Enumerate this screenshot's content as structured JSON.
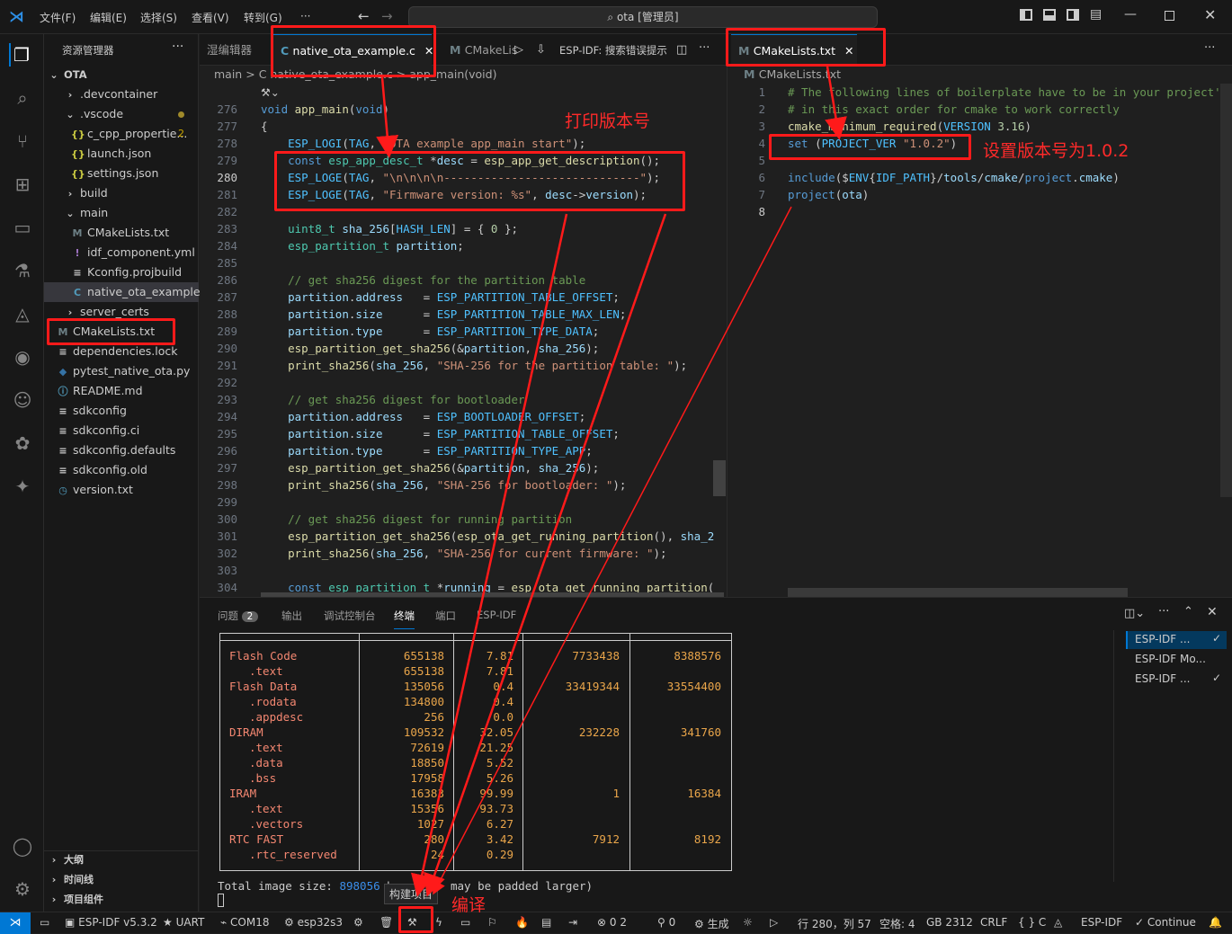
{
  "titlebar": {
    "menus": [
      "文件(F)",
      "编辑(E)",
      "选择(S)",
      "查看(V)",
      "转到(G)",
      "···"
    ],
    "search_text": "ota [管理员]"
  },
  "sidebar": {
    "title": "资源管理器",
    "root": "OTA",
    "items": [
      {
        "label": ".devcontainer",
        "icon": "chevron-right"
      },
      {
        "label": ".vscode",
        "icon": "chevron-down"
      },
      {
        "label": "c_cpp_propertie...",
        "icon": "json",
        "badge": "2"
      },
      {
        "label": "launch.json",
        "icon": "json"
      },
      {
        "label": "settings.json",
        "icon": "json"
      },
      {
        "label": "build",
        "icon": "chevron-right"
      },
      {
        "label": "main",
        "icon": "chevron-down"
      },
      {
        "label": "CMakeLists.txt",
        "icon": "cmake"
      },
      {
        "label": "idf_component.yml",
        "icon": "yaml"
      },
      {
        "label": "Kconfig.projbuild",
        "icon": "lines"
      },
      {
        "label": "native_ota_example.c",
        "icon": "c"
      },
      {
        "label": "server_certs",
        "icon": "chevron-right"
      },
      {
        "label": "CMakeLists.txt",
        "icon": "cmake"
      },
      {
        "label": "dependencies.lock",
        "icon": "lines"
      },
      {
        "label": "pytest_native_ota.py",
        "icon": "python"
      },
      {
        "label": "README.md",
        "icon": "info"
      },
      {
        "label": "sdkconfig",
        "icon": "lines"
      },
      {
        "label": "sdkconfig.ci",
        "icon": "lines"
      },
      {
        "label": "sdkconfig.defaults",
        "icon": "lines"
      },
      {
        "label": "sdkconfig.old",
        "icon": "lines"
      },
      {
        "label": "version.txt",
        "icon": "clock"
      }
    ],
    "sections": [
      "大纲",
      "时间线",
      "项目组件"
    ]
  },
  "editor1": {
    "tabs": [
      "湿编辑器",
      "native_ota_example.c",
      "CMakeLis",
      "ESP-IDF:  搜索错误提示"
    ],
    "breadcrumb": [
      "main",
      ">",
      "C native_ota_example.c",
      ">",
      "app_main(void)"
    ],
    "lines": [
      {
        "n": "276",
        "t": "void app_main(void)"
      },
      {
        "n": "277",
        "t": "{"
      },
      {
        "n": "278",
        "t": "    ESP_LOGI(TAG, \"OTA example app_main start\");"
      },
      {
        "n": "279",
        "t": "    const esp_app_desc_t *desc = esp_app_get_description();"
      },
      {
        "n": "280",
        "t": "    ESP_LOGE(TAG, \"\\n\\n\\n\\n-----------------------------\");"
      },
      {
        "n": "281",
        "t": "    ESP_LOGE(TAG, \"Firmware version: %s\", desc->version);"
      },
      {
        "n": "282",
        "t": ""
      },
      {
        "n": "283",
        "t": "    uint8_t sha_256[HASH_LEN] = { 0 };"
      },
      {
        "n": "284",
        "t": "    esp_partition_t partition;"
      },
      {
        "n": "285",
        "t": ""
      },
      {
        "n": "286",
        "t": "    // get sha256 digest for the partition table"
      },
      {
        "n": "287",
        "t": "    partition.address   = ESP_PARTITION_TABLE_OFFSET;"
      },
      {
        "n": "288",
        "t": "    partition.size      = ESP_PARTITION_TABLE_MAX_LEN;"
      },
      {
        "n": "289",
        "t": "    partition.type      = ESP_PARTITION_TYPE_DATA;"
      },
      {
        "n": "290",
        "t": "    esp_partition_get_sha256(&partition, sha_256);"
      },
      {
        "n": "291",
        "t": "    print_sha256(sha_256, \"SHA-256 for the partition table: \");"
      },
      {
        "n": "292",
        "t": ""
      },
      {
        "n": "293",
        "t": "    // get sha256 digest for bootloader"
      },
      {
        "n": "294",
        "t": "    partition.address   = ESP_BOOTLOADER_OFFSET;"
      },
      {
        "n": "295",
        "t": "    partition.size      = ESP_PARTITION_TABLE_OFFSET;"
      },
      {
        "n": "296",
        "t": "    partition.type      = ESP_PARTITION_TYPE_APP;"
      },
      {
        "n": "297",
        "t": "    esp_partition_get_sha256(&partition, sha_256);"
      },
      {
        "n": "298",
        "t": "    print_sha256(sha_256, \"SHA-256 for bootloader: \");"
      },
      {
        "n": "299",
        "t": ""
      },
      {
        "n": "300",
        "t": "    // get sha256 digest for running partition"
      },
      {
        "n": "301",
        "t": "    esp_partition_get_sha256(esp_ota_get_running_partition(), sha_2"
      },
      {
        "n": "302",
        "t": "    print_sha256(sha_256, \"SHA-256 for current firmware: \");"
      },
      {
        "n": "303",
        "t": ""
      },
      {
        "n": "304",
        "t": "    const esp_partition_t *running = esp_ota_get_running_partition("
      }
    ]
  },
  "editor2": {
    "tab": "CMakeLists.txt",
    "breadcrumb": "CMakeLists.txt",
    "lines": [
      {
        "n": "1",
        "t": "# The following lines of boilerplate have to be in your project'"
      },
      {
        "n": "2",
        "t": "# in this exact order for cmake to work correctly"
      },
      {
        "n": "3",
        "t": "cmake_minimum_required(VERSION 3.16)"
      },
      {
        "n": "4",
        "t": "set (PROJECT_VER \"1.0.2\")"
      },
      {
        "n": "5",
        "t": ""
      },
      {
        "n": "6",
        "t": "include($ENV{IDF_PATH}/tools/cmake/project.cmake)"
      },
      {
        "n": "7",
        "t": "project(ota)"
      },
      {
        "n": "8",
        "t": ""
      }
    ]
  },
  "panel": {
    "tabs": [
      "问题",
      "输出",
      "调试控制台",
      "终端",
      "端口",
      "ESP-IDF"
    ],
    "problems_count": "2",
    "terminals": [
      "ESP-IDF ...",
      "ESP-IDF Mo...",
      "ESP-IDF ..."
    ],
    "table": [
      {
        "name": "Flash Code",
        "a": "655138",
        "b": "7.81",
        "c": "7733438",
        "d": "8388576",
        "indent": false
      },
      {
        "name": ".text",
        "a": "655138",
        "b": "7.81",
        "c": "",
        "d": "",
        "indent": true
      },
      {
        "name": "Flash Data",
        "a": "135056",
        "b": "0.4",
        "c": "33419344",
        "d": "33554400",
        "indent": false
      },
      {
        "name": ".rodata",
        "a": "134800",
        "b": "0.4",
        "c": "",
        "d": "",
        "indent": true
      },
      {
        "name": ".appdesc",
        "a": "256",
        "b": "0.0",
        "c": "",
        "d": "",
        "indent": true
      },
      {
        "name": "DIRAM",
        "a": "109532",
        "b": "32.05",
        "c": "232228",
        "d": "341760",
        "indent": false
      },
      {
        "name": ".text",
        "a": "72619",
        "b": "21.25",
        "c": "",
        "d": "",
        "indent": true
      },
      {
        "name": ".data",
        "a": "18850",
        "b": "5.52",
        "c": "",
        "d": "",
        "indent": true
      },
      {
        "name": ".bss",
        "a": "17958",
        "b": "5.26",
        "c": "",
        "d": "",
        "indent": true
      },
      {
        "name": "IRAM",
        "a": "16383",
        "b": "99.99",
        "c": "1",
        "d": "16384",
        "indent": false
      },
      {
        "name": ".text",
        "a": "15356",
        "b": "93.73",
        "c": "",
        "d": "",
        "indent": true
      },
      {
        "name": ".vectors",
        "a": "1027",
        "b": "6.27",
        "c": "",
        "d": "",
        "indent": true
      },
      {
        "name": "RTC FAST",
        "a": "280",
        "b": "3.42",
        "c": "7912",
        "d": "8192",
        "indent": false
      },
      {
        "name": ".rtc_reserved",
        "a": "24",
        "b": "0.29",
        "c": "",
        "d": "",
        "indent": true
      }
    ],
    "total_label": "Total image size: ",
    "total_value": "898056",
    "total_suffix": " b",
    "total_tail": "may be padded larger)",
    "tooltip": "构建项目"
  },
  "statusbar": {
    "items": [
      "ESP-IDF v5.3.2",
      "UART",
      "COM18",
      "esp32s3",
      "0 2",
      "0",
      "生成",
      "行 280，列 57",
      "空格: 4",
      "GB 2312",
      "CRLF",
      "{ } C",
      "ESP-IDF",
      "Continue"
    ]
  },
  "annotations": {
    "print_version": "打印版本号",
    "set_version": "设置版本号为1.0.2",
    "build": "编译"
  },
  "colors": {
    "accent": "#0078d4",
    "annotation": "#ff1a1a",
    "terminal_label": "#f48771",
    "terminal_value": "#e9a54a",
    "terminal_total": "#3b8eea"
  }
}
